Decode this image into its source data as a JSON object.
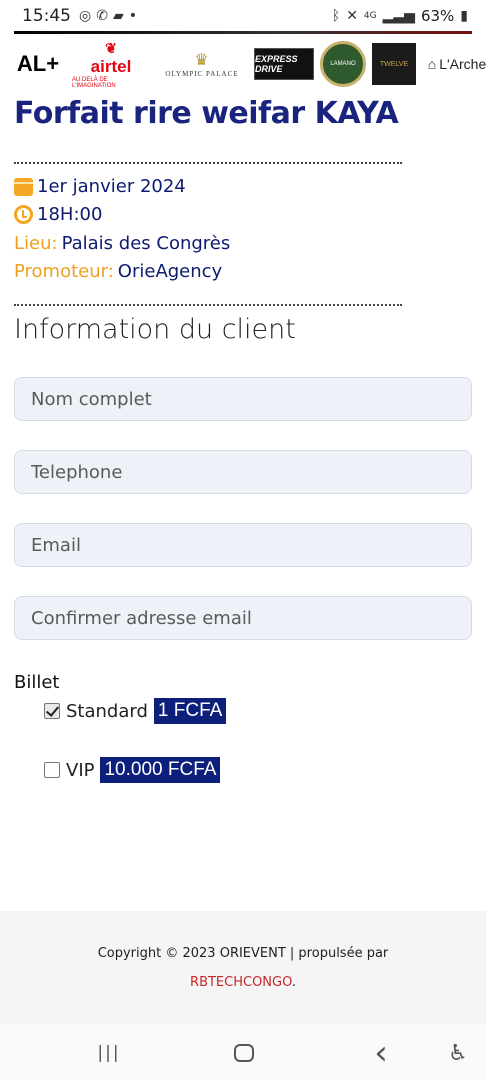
{
  "status_bar": {
    "time": "15:45",
    "battery": "63%",
    "left_icons": [
      "instagram-icon",
      "whatsapp-icon",
      "message-icon",
      "dot-icon"
    ],
    "right_icons": [
      "bluetooth-icon",
      "mute-icon",
      "4g-icon",
      "signal-icon",
      "battery-icon"
    ]
  },
  "sponsors": [
    {
      "name": "AL+"
    },
    {
      "name": "airtel",
      "tagline": "AU DELÀ DE L'IMAGINATION"
    },
    {
      "name": "OLYMPIC PALACE"
    },
    {
      "name": "EXPRESS DRIVE"
    },
    {
      "name": "LAMANO"
    },
    {
      "name": "TWELVE"
    },
    {
      "name": "L'Arche"
    }
  ],
  "event": {
    "title": "Forfait rire weifar KAYA",
    "date": "1er janvier 2024",
    "time": "18H:00",
    "venue_label": "Lieu:",
    "venue": "Palais des Congrès",
    "promoter_label": "Promoteur:",
    "promoter": "OrieAgency"
  },
  "form": {
    "section_title": "Information du client",
    "fields": {
      "full_name_placeholder": "Nom complet",
      "phone_placeholder": "Telephone",
      "email_placeholder": "Email",
      "confirm_email_placeholder": "Confirmer adresse email"
    },
    "ticket_label": "Billet",
    "options": [
      {
        "label": "Standard",
        "price": "1 FCFA",
        "checked": true
      },
      {
        "label": "VIP",
        "price": "10.000 FCFA",
        "checked": false
      }
    ]
  },
  "footer": {
    "copyright": "Copyright © 2023 ORIEVENT | propulsée par",
    "link": "RBTECHCONGO",
    "suffix": "."
  },
  "nav": {
    "recents": "|||",
    "home": "◯",
    "back": "‹",
    "accessibility": "⚲"
  }
}
